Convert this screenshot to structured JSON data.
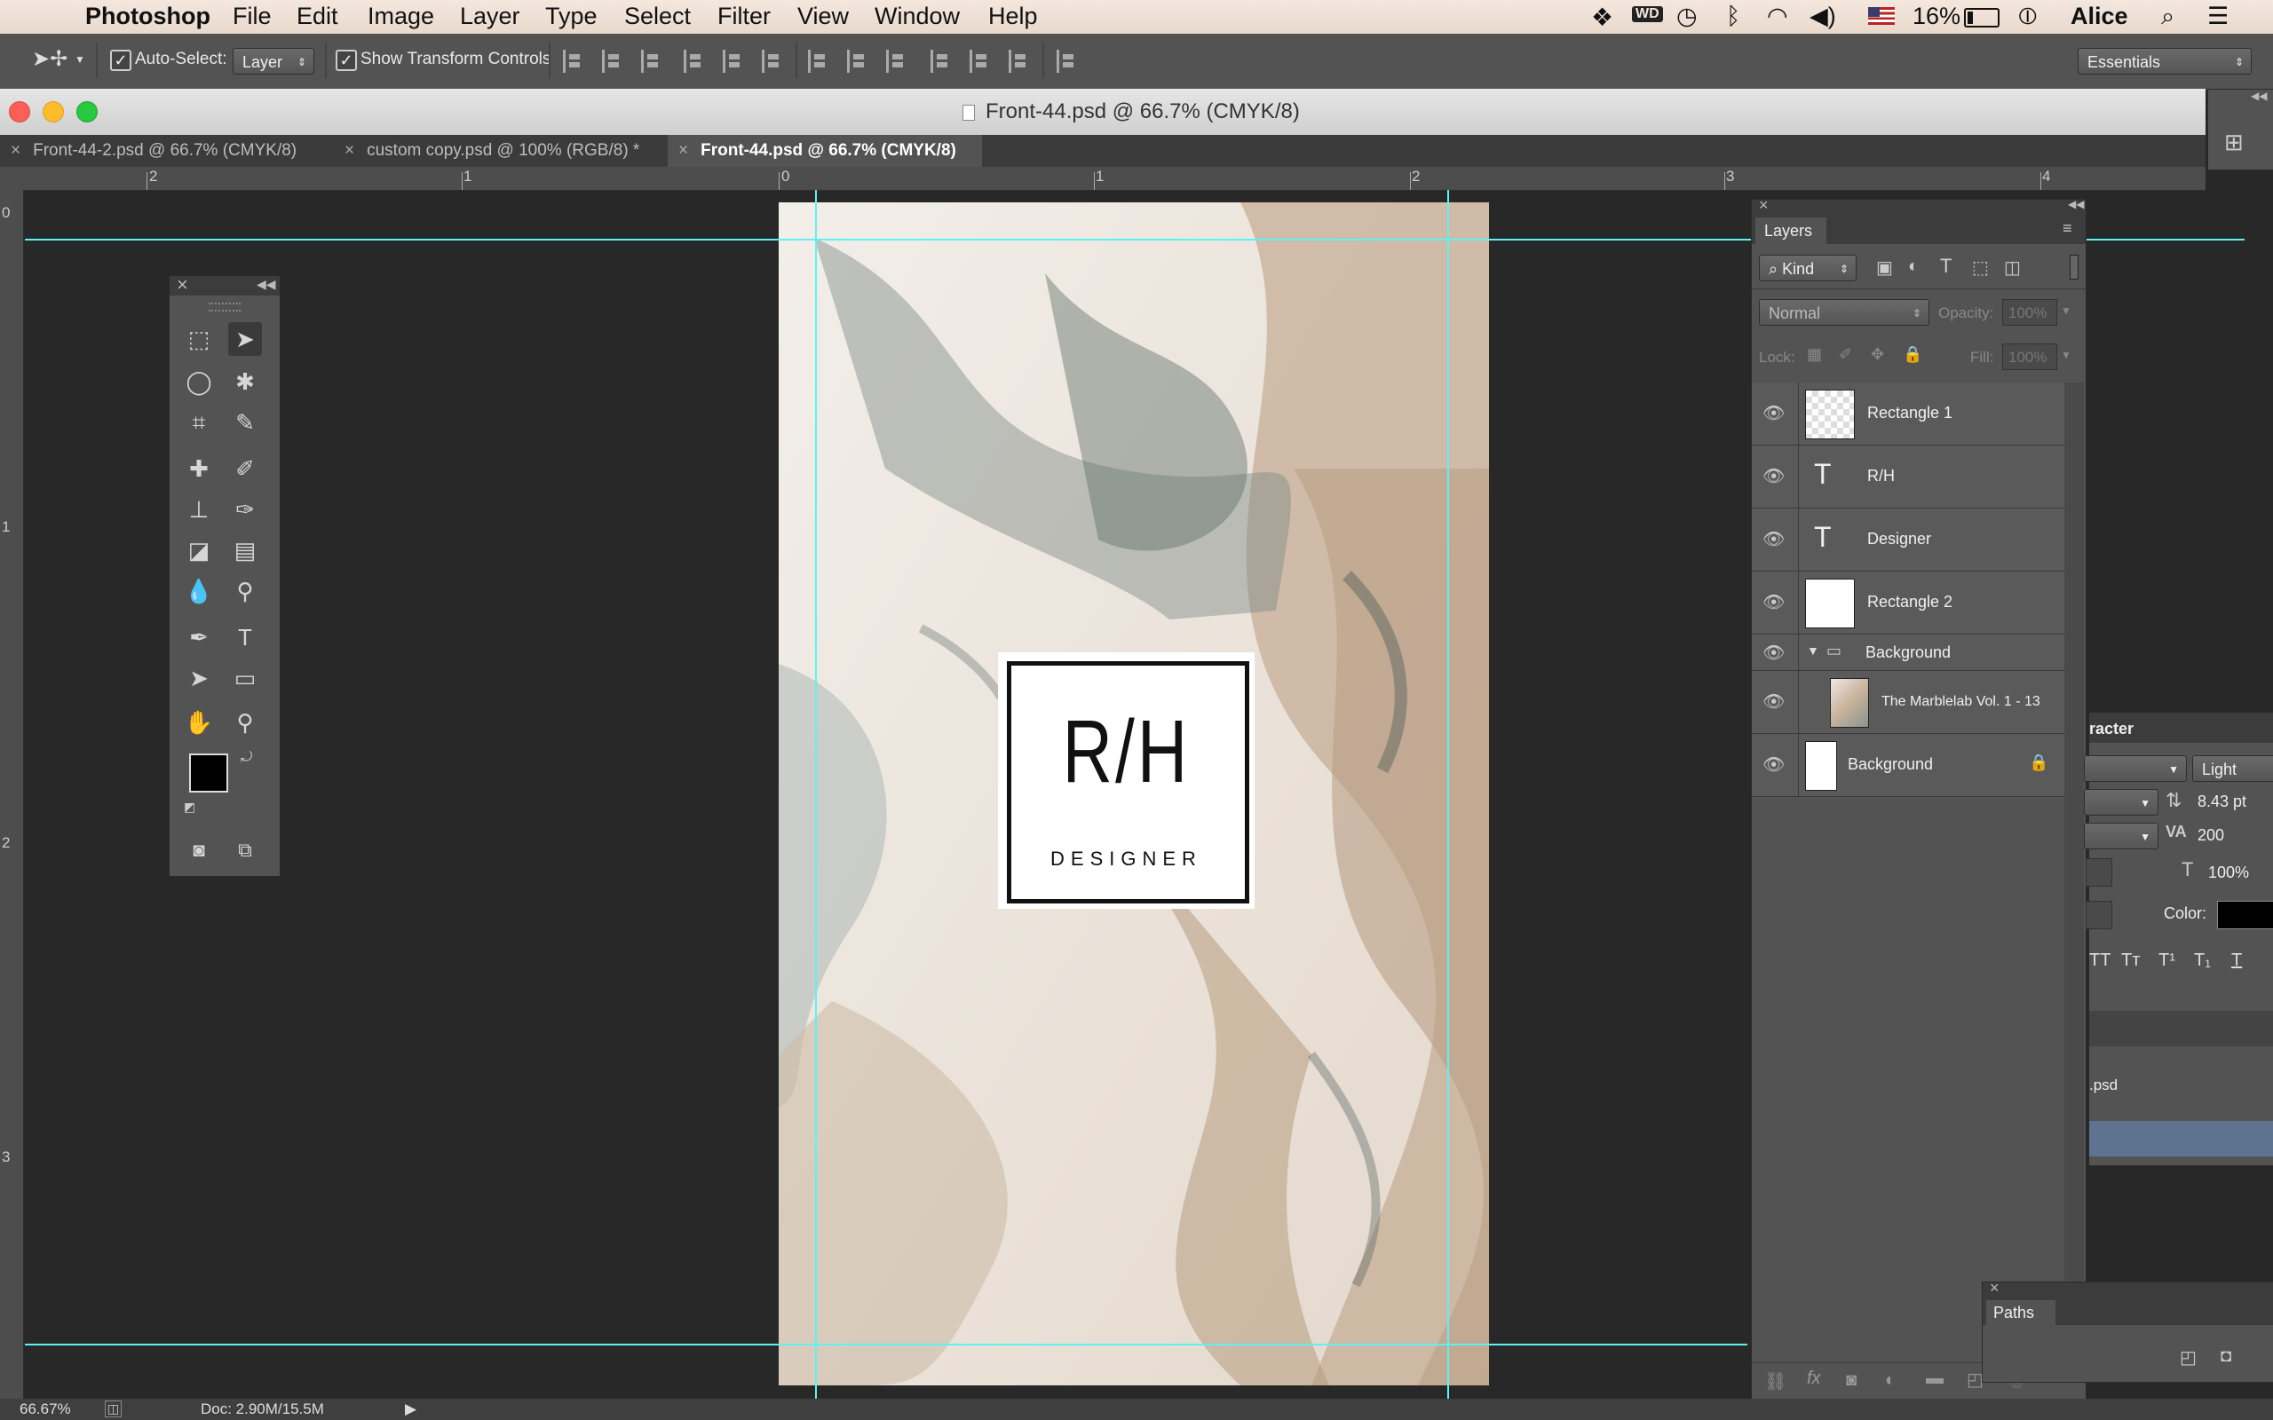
{
  "menubar": {
    "apple_icon": "apple-icon",
    "app_name": "Photoshop",
    "items": [
      "File",
      "Edit",
      "Image",
      "Layer",
      "Type",
      "Select",
      "Filter",
      "View",
      "Window",
      "Help"
    ],
    "battery": "16%",
    "user": "Alice"
  },
  "options_bar": {
    "auto_select_label": "Auto-Select:",
    "auto_select_value": "Layer",
    "show_transform_label": "Show Transform Controls",
    "workspace": "Essentials"
  },
  "document": {
    "window_title": "Front-44.psd @ 66.7% (CMYK/8)",
    "tabs": [
      {
        "label": "Front-44-2.psd @ 66.7% (CMYK/8)"
      },
      {
        "label": "custom copy.psd @ 100% (RGB/8) *"
      },
      {
        "label": "Front-44.psd @ 66.7% (CMYK/8)"
      }
    ],
    "ruler_h": [
      "2",
      "1",
      "0",
      "1",
      "2",
      "3",
      "4"
    ],
    "ruler_v": [
      "0",
      "1",
      "2",
      "3"
    ],
    "logo_main": "R/H",
    "logo_sub": "DESIGNER"
  },
  "layers_panel": {
    "title": "Layers",
    "filter_kind": "Kind",
    "blend_mode": "Normal",
    "opacity_label": "Opacity:",
    "opacity_value": "100%",
    "lock_label": "Lock:",
    "fill_label": "Fill:",
    "fill_value": "100%",
    "layers": [
      {
        "name": "Rectangle 1"
      },
      {
        "name": "R/H"
      },
      {
        "name": "Designer"
      },
      {
        "name": "Rectangle 2"
      },
      {
        "name": "Background"
      },
      {
        "name": "The Marblelab Vol. 1 - 13"
      },
      {
        "name": "Background"
      }
    ]
  },
  "character_panel": {
    "title_fragment": "racter",
    "font_style": "Light",
    "leading": "8.43 pt",
    "tracking": "200",
    "scale": "100%",
    "color_label": "Color:",
    "doc_fragment": ".psd"
  },
  "paths_panel": {
    "title": "Paths"
  },
  "status": {
    "zoom": "66.67%",
    "doc_size": "Doc: 2.90M/15.5M"
  },
  "colors": {
    "guide": "#5ff2f2",
    "panel": "#535353",
    "canvas_bg": "#282828"
  }
}
